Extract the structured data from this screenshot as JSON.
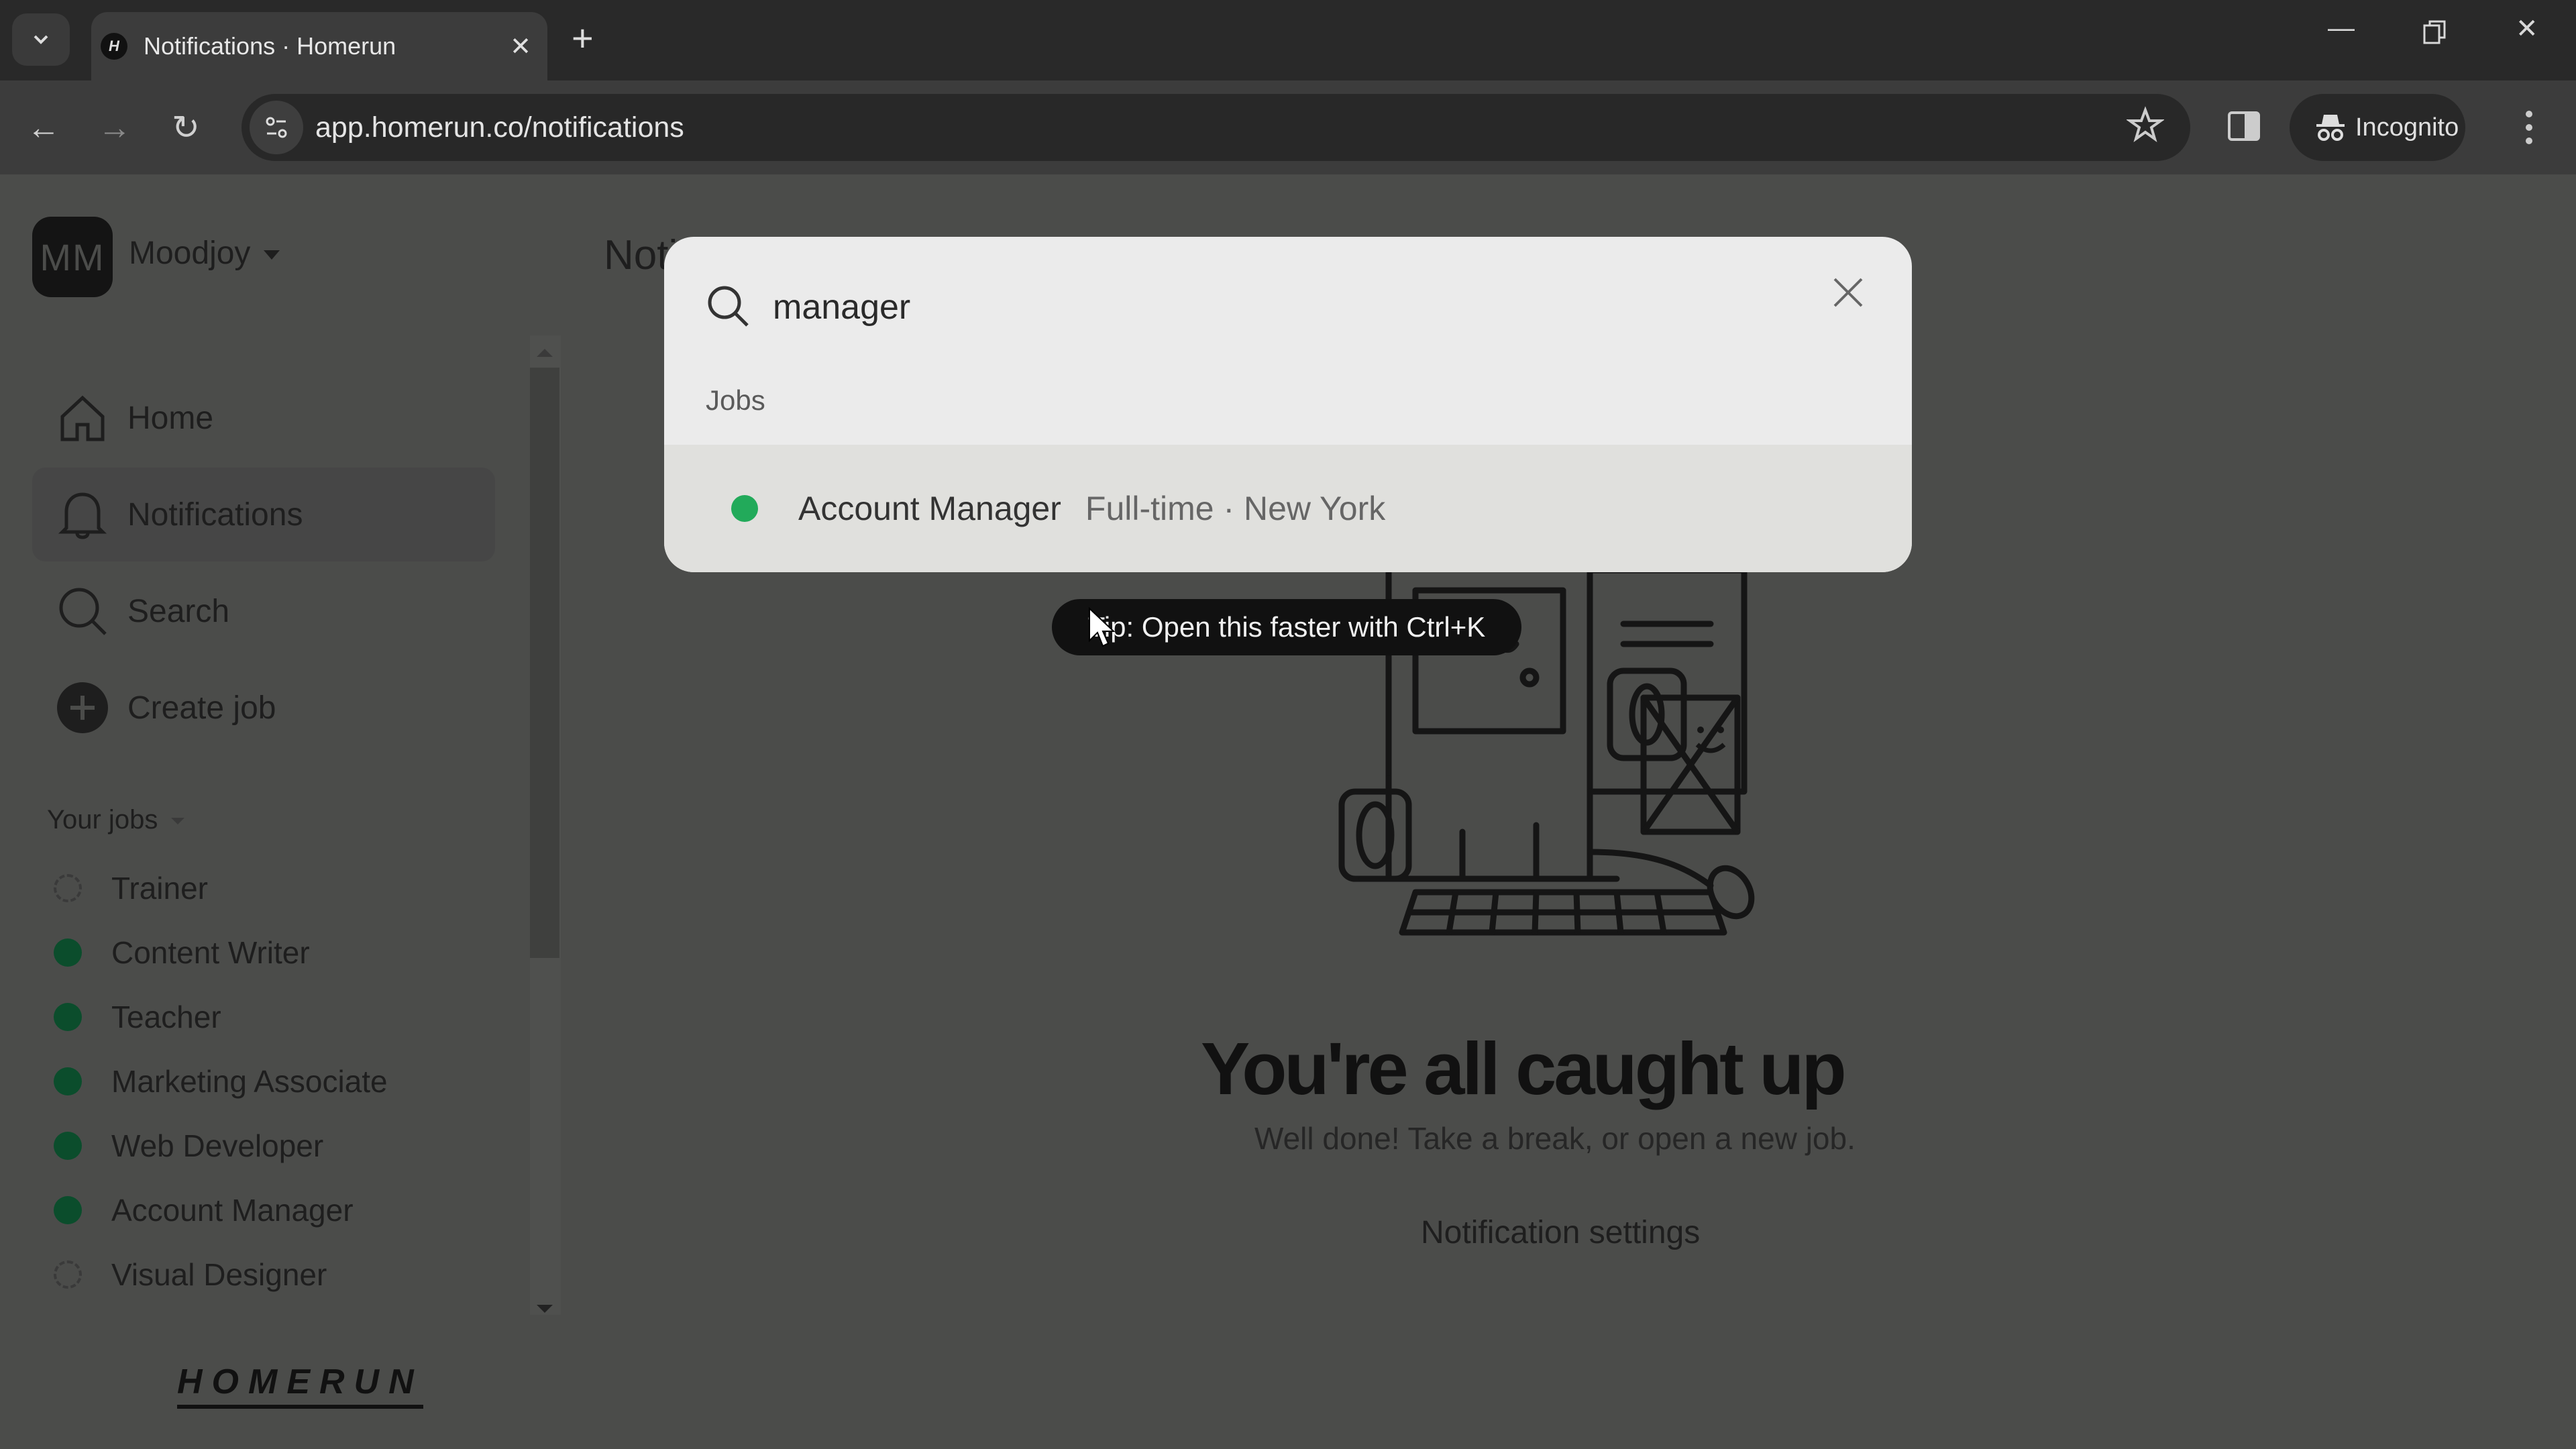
{
  "browser": {
    "tab_title": "Notifications · Homerun",
    "tab_favicon": "H",
    "url": "app.homerun.co/notifications",
    "profile_label": "Incognito"
  },
  "sidebar": {
    "avatar_initials": "MM",
    "org_name": "Moodjoy",
    "nav": [
      {
        "label": "Home",
        "icon": "home-icon"
      },
      {
        "label": "Notifications",
        "icon": "bell-icon",
        "active": true
      },
      {
        "label": "Search",
        "icon": "search-icon"
      },
      {
        "label": "Create job",
        "icon": "plus-circle-icon"
      }
    ],
    "jobs_header": "Your jobs",
    "jobs": [
      {
        "label": "Trainer",
        "status": "draft"
      },
      {
        "label": "Content Writer",
        "status": "published"
      },
      {
        "label": "Teacher",
        "status": "published"
      },
      {
        "label": "Marketing Associate",
        "status": "published"
      },
      {
        "label": "Web Developer",
        "status": "published"
      },
      {
        "label": "Account Manager",
        "status": "published"
      },
      {
        "label": "Visual Designer",
        "status": "draft"
      }
    ],
    "logo": "HOMERUN"
  },
  "main": {
    "page_title": "Noti",
    "headline": "You're all caught up",
    "subtext": "Well done! Take a break, or open a new job.",
    "settings_link": "Notification settings"
  },
  "search_modal": {
    "query": "manager",
    "section_label": "Jobs",
    "results": [
      {
        "name": "Account Manager",
        "meta": "Full-time · New York",
        "status_color": "#22aa5a"
      }
    ],
    "tip": "Tip: Open this faster with Ctrl+K"
  },
  "colors": {
    "published": "#0b4d2c",
    "result_dot": "#22aa5a",
    "overlay": "#4b4c4a"
  }
}
